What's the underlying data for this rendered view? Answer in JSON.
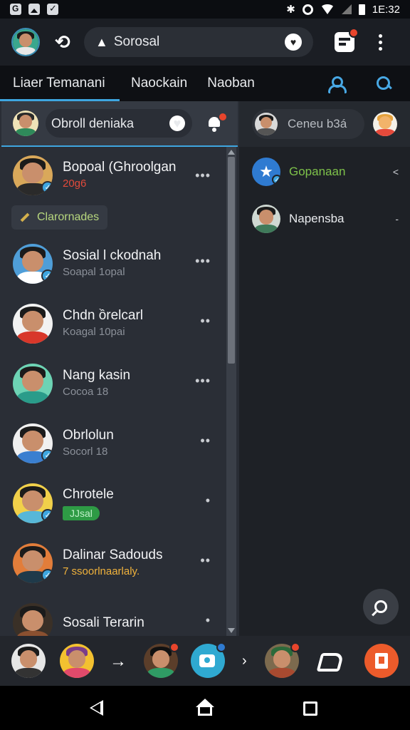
{
  "status_bar": {
    "time": "1E:32"
  },
  "app_bar": {
    "search_text": "Sorosal"
  },
  "tabs": [
    {
      "label": "Liaer Temanani",
      "active": true
    },
    {
      "label": "Naockain",
      "active": false
    },
    {
      "label": "Naoban",
      "active": false
    }
  ],
  "chat_search": {
    "text": "Obroll deniaka"
  },
  "section_chip": {
    "label": "Clarornades"
  },
  "chats": [
    {
      "name": "Bopoal (Ghroolgan",
      "sub": "20g6",
      "sub_style": "red",
      "bg": "#d9a85a",
      "shirt": "#2a2a2a",
      "hair": "#1b1b1b",
      "verified": true
    },
    {
      "name": "Sosial l ckodnah",
      "sub": "Soapal 1opal",
      "sub_style": "gray",
      "bg": "#4f9ed8",
      "shirt": "#ffffff",
      "hair": "#1b1b1b",
      "verified": true
    },
    {
      "name": "Chdn ồrelcarl",
      "sub": "Koagal 10pai",
      "sub_style": "gray",
      "bg": "#f2f2f2",
      "shirt": "#d8372a",
      "hair": "#1b1b1b",
      "verified": false
    },
    {
      "name": "Nang kasin",
      "sub": "Cocoa 18",
      "sub_style": "gray",
      "bg": "#6dd3b4",
      "shirt": "#2a9c8a",
      "hair": "#1b1b1b",
      "verified": false
    },
    {
      "name": "Obrlolun",
      "sub": "Socorl 18",
      "sub_style": "gray",
      "bg": "#f0f0f0",
      "shirt": "#3a7fd0",
      "hair": "#1b1b1b",
      "verified": true
    },
    {
      "name": "Chrotele",
      "sub": "JJsal",
      "sub_style": "pill",
      "bg": "#f1d04a",
      "shirt": "#57b7d8",
      "hair": "#1b1b1b",
      "verified": true
    },
    {
      "name": "Dalinar Sadouds",
      "sub": "7 ssoorlnaarlaly.",
      "sub_style": "yellow",
      "bg": "#e27d3a",
      "shirt": "#1f3a4a",
      "hair": "#1b1b1b",
      "verified": true
    },
    {
      "name": "Sosali Terarin",
      "sub": "",
      "sub_style": "gray",
      "bg": "#3a3027",
      "shirt": "#8a5030",
      "hair": "#1b1b1b",
      "verified": false
    }
  ],
  "right_panel": {
    "header_text": "Ceneu b3á",
    "items": [
      {
        "label": "Gopanaan",
        "color": "#7ec24a",
        "chevron": "<"
      },
      {
        "label": "Napensba",
        "color": "#e8eaed",
        "chevron": "-"
      }
    ]
  },
  "dock_arrow": "→",
  "dock_arrow_small": "›"
}
